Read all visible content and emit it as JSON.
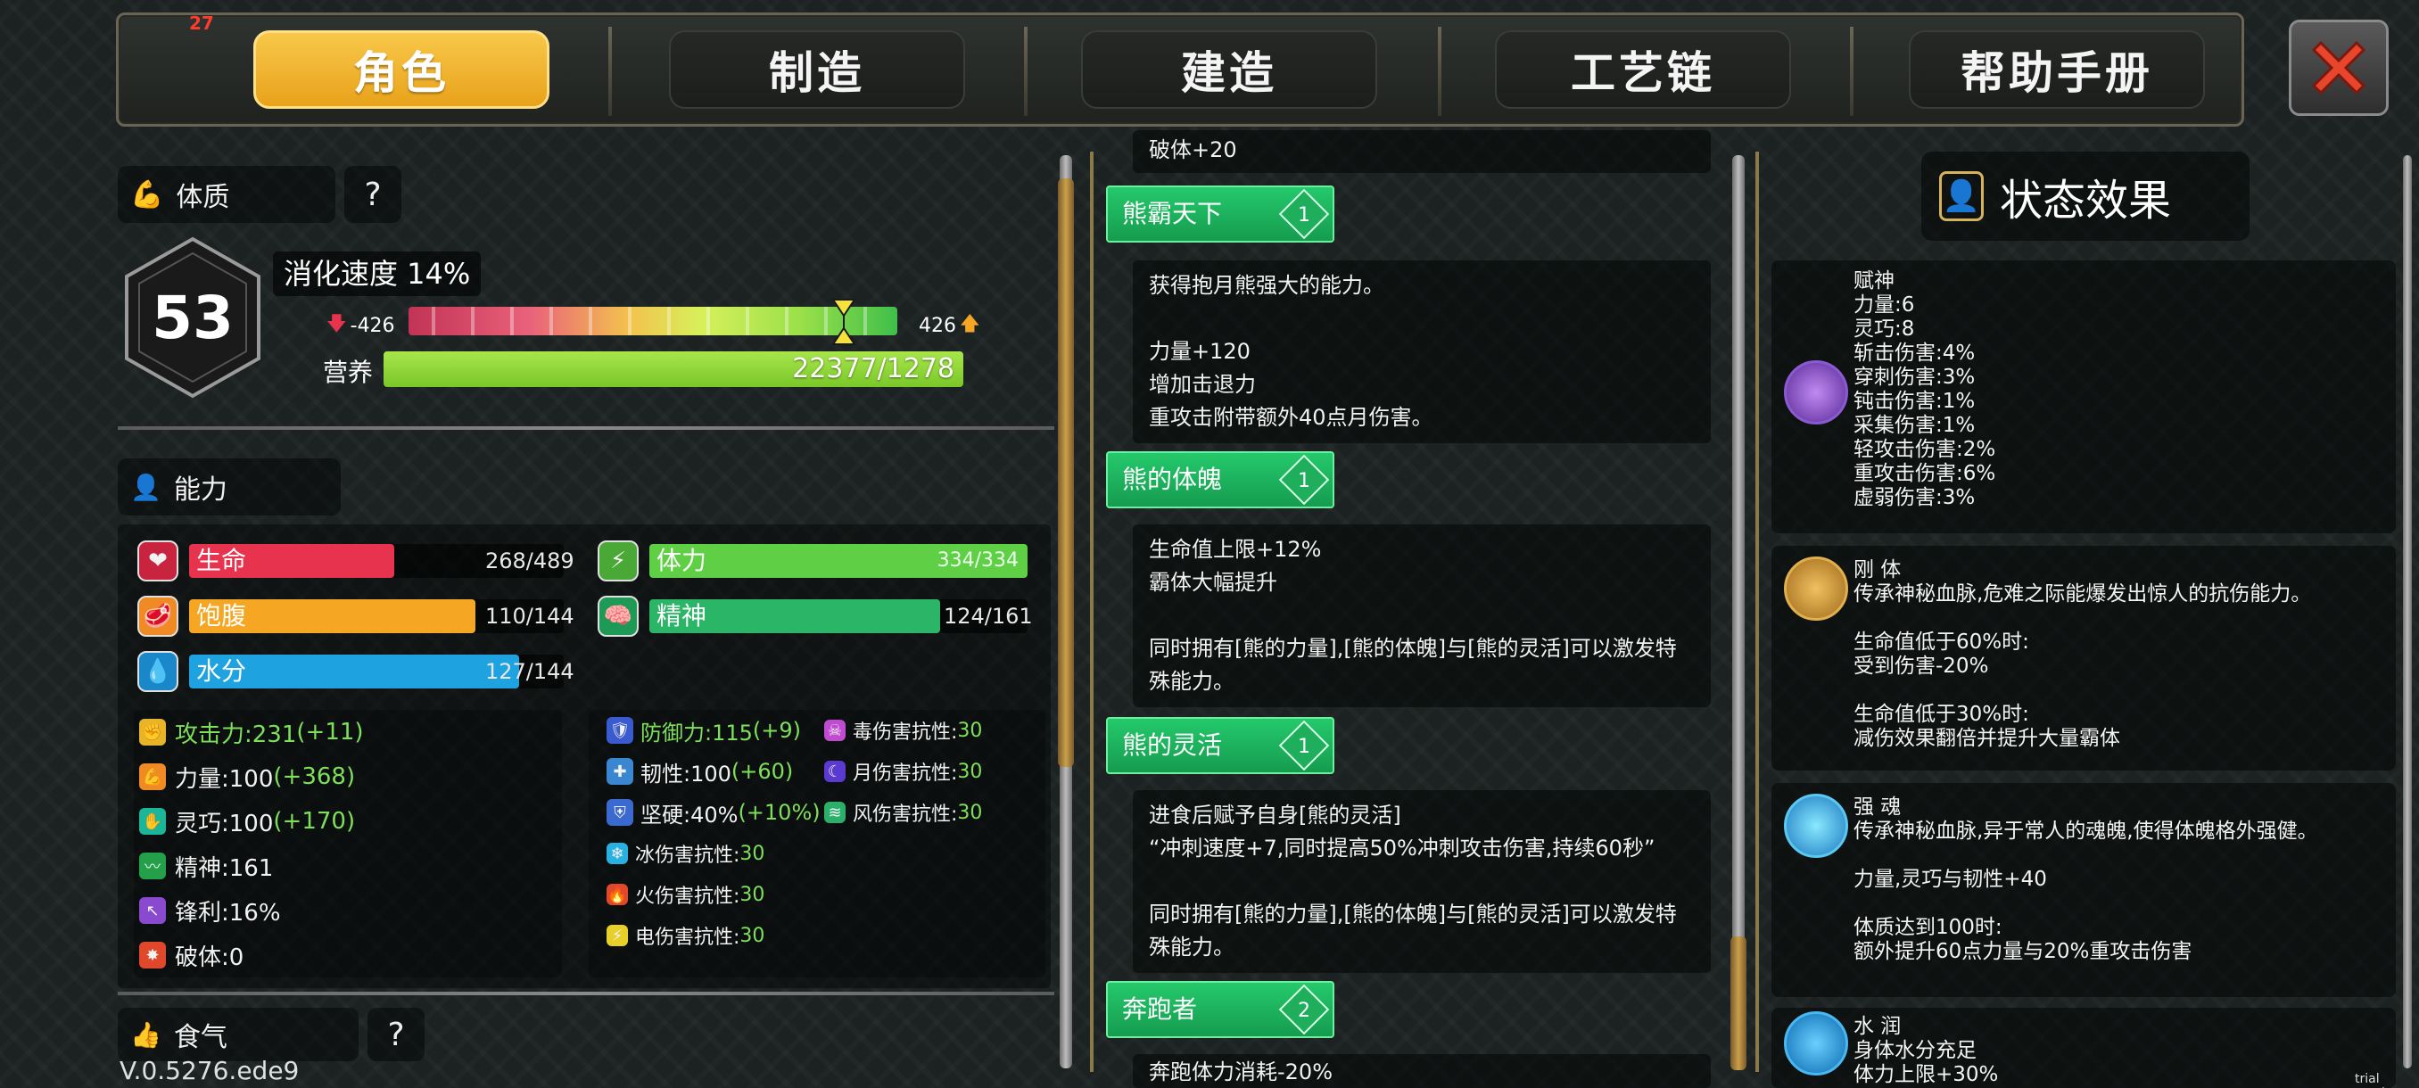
{
  "tabs": [
    {
      "label": "角色",
      "active": true
    },
    {
      "label": "制造",
      "active": false
    },
    {
      "label": "建造",
      "active": false
    },
    {
      "label": "工艺链",
      "active": false
    },
    {
      "label": "帮助手册",
      "active": false
    }
  ],
  "notification_count": "27",
  "constitution": {
    "title": "体质",
    "help": "?",
    "level": "53",
    "digest_speed": "消化速度 14%",
    "left_value": "-426",
    "right_value": "426",
    "digest_marker_fraction": 0.89,
    "nutrition_label": "营养",
    "nutrition_value": "22377/1278"
  },
  "ability": {
    "title": "能力",
    "bars": {
      "hp": {
        "label": "生命",
        "value": "268/489",
        "fraction": 0.548,
        "color": "#e8334f"
      },
      "satiety": {
        "label": "饱腹",
        "value": "110/144",
        "fraction": 0.764,
        "color": "#f5a623"
      },
      "water": {
        "label": "水分",
        "value": "127/144",
        "fraction": 0.882,
        "color": "#1fa3e0"
      },
      "stamina": {
        "label": "体力",
        "value": "334/334",
        "fraction": 1.0,
        "color": "#5fcf45"
      },
      "spirit": {
        "label": "精神",
        "value": "124/161",
        "fraction": 0.77,
        "color": "#2bb566"
      }
    },
    "stats": [
      {
        "label": "攻击力:231",
        "bonus": "(+11)",
        "label_green": true,
        "icon": "attack-icon"
      },
      {
        "label": "力量:100",
        "bonus": "(+368)",
        "label_green": false,
        "icon": "strength-icon"
      },
      {
        "label": "灵巧:100",
        "bonus": "(+170)",
        "label_green": false,
        "icon": "dexterity-icon"
      },
      {
        "label": "精神:161",
        "bonus": "",
        "label_green": false,
        "icon": "spirit-stat-icon"
      },
      {
        "label": "锋利:16%",
        "bonus": "",
        "label_green": false,
        "icon": "sharpness-icon"
      },
      {
        "label": "破体:0",
        "bonus": "",
        "label_green": false,
        "icon": "penetration-icon"
      }
    ],
    "defense": [
      {
        "label": "防御力:115",
        "bonus": "(+9)",
        "label_green": true
      },
      {
        "label": "韧性:100",
        "bonus": "(+60)",
        "label_green": false
      },
      {
        "label": "坚硬:40%",
        "bonus": "(+10%)",
        "label_green": false
      }
    ],
    "resists": [
      {
        "label": "毒伤害抗性:",
        "value": "30"
      },
      {
        "label": "月伤害抗性:",
        "value": "30"
      },
      {
        "label": "风伤害抗性:",
        "value": "30"
      },
      {
        "label": "冰伤害抗性:",
        "value": "30"
      },
      {
        "label": "火伤害抗性:",
        "value": "30"
      },
      {
        "label": "电伤害抗性:",
        "value": "30"
      }
    ]
  },
  "appetite": {
    "title": "食气",
    "help": "?"
  },
  "skills_top_cut": "破体+20",
  "skills": [
    {
      "name": "熊霸天下",
      "level": "1",
      "lines": [
        "获得抱月熊强大的能力。",
        "",
        "力量+120",
        "增加击退力",
        "重攻击附带额外40点月伤害。"
      ]
    },
    {
      "name": "熊的体魄",
      "level": "1",
      "lines": [
        "生命值上限+12%",
        "霸体大幅提升",
        "",
        "同时拥有[熊的力量],[熊的体魄]与[熊的灵活]可以激发特",
        "殊能力。"
      ]
    },
    {
      "name": "熊的灵活",
      "level": "1",
      "lines": [
        "进食后赋予自身[熊的灵活]",
        " “冲刺速度+7,同时提高50%冲刺攻击伤害,持续60秒”",
        "",
        "同时拥有[熊的力量],[熊的体魄]与[熊的灵活]可以激发特",
        "殊能力。"
      ]
    },
    {
      "name": "奔跑者",
      "level": "2",
      "lines": [
        "奔跑体力消耗-20%"
      ]
    }
  ],
  "status": {
    "title": "状态效果",
    "effects": [
      {
        "name": "赋神",
        "lines": [
          "力量:6",
          "灵巧:8",
          "斩击伤害:4%",
          "穿刺伤害:3%",
          "钝击伤害:1%",
          "采集伤害:1%",
          "轻攻击伤害:2%",
          "重攻击伤害:6%",
          "虚弱伤害:3%"
        ]
      },
      {
        "name": "刚 体",
        "lines": [
          "传承神秘血脉,危难之际能爆发出惊人的抗伤能力。",
          "",
          "生命值低于60%时:",
          "受到伤害-20%",
          "",
          "生命值低于30%时:",
          "减伤效果翻倍并提升大量霸体"
        ]
      },
      {
        "name": "强 魂",
        "lines": [
          "传承神秘血脉,异于常人的魂魄,使得体魄格外强健。",
          "",
          "力量,灵巧与韧性+40",
          "",
          "体质达到100时:",
          "额外提升60点力量与20%重攻击伤害"
        ]
      },
      {
        "name": "水 润",
        "lines": [
          "身体水分充足",
          "体力上限+30%"
        ]
      }
    ]
  },
  "version": "V.0.5276.ede9",
  "watermark": "trial version"
}
